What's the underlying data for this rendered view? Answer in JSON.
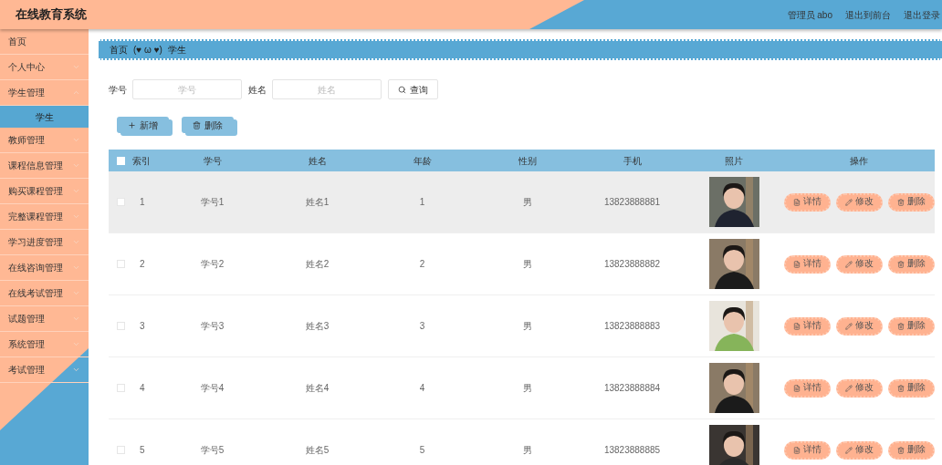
{
  "header": {
    "title": "在线教育系统",
    "links": [
      "管理员 abo",
      "退出到前台",
      "退出登录"
    ]
  },
  "sidebar": {
    "items": [
      {
        "label": "首页",
        "has_children": false,
        "selected": false
      },
      {
        "label": "个人中心",
        "expanded": false,
        "has_children": true,
        "selected": false
      },
      {
        "label": "学生管理",
        "expanded": true,
        "has_children": true,
        "selected": false,
        "children": [
          {
            "label": "学生",
            "selected": true
          }
        ]
      },
      {
        "label": "教师管理",
        "expanded": false,
        "has_children": true,
        "selected": false
      },
      {
        "label": "课程信息管理",
        "expanded": false,
        "has_children": true,
        "selected": false
      },
      {
        "label": "购买课程管理",
        "expanded": false,
        "has_children": true,
        "selected": false
      },
      {
        "label": "完整课程管理",
        "expanded": false,
        "has_children": true,
        "selected": false
      },
      {
        "label": "学习进度管理",
        "expanded": false,
        "has_children": true,
        "selected": false
      },
      {
        "label": "在线咨询管理",
        "expanded": false,
        "has_children": true,
        "selected": false
      },
      {
        "label": "在线考试管理",
        "expanded": false,
        "has_children": true,
        "selected": false
      },
      {
        "label": "试题管理",
        "expanded": false,
        "has_children": true,
        "selected": false
      },
      {
        "label": "系统管理",
        "expanded": false,
        "has_children": true,
        "selected": false
      },
      {
        "label": "考试管理",
        "expanded": false,
        "has_children": true,
        "selected": false
      }
    ]
  },
  "breadcrumb": [
    "首页",
    "(♥ ω ♥)",
    "学生"
  ],
  "search": {
    "fields": [
      {
        "label": "学号",
        "placeholder": "学号"
      },
      {
        "label": "姓名",
        "placeholder": "姓名"
      }
    ],
    "button": "查询"
  },
  "actions": [
    "新增",
    "删除"
  ],
  "table": {
    "columns": [
      "索引",
      "学号",
      "姓名",
      "年龄",
      "性别",
      "手机",
      "照片",
      "操作"
    ],
    "select_all_checked": false,
    "rows": [
      {
        "checked": false,
        "highlighted": true,
        "cells": [
          "1",
          "学号1",
          "姓名1",
          "1",
          "男",
          "13823888881"
        ],
        "buttons": [
          "详情",
          "修改",
          "删除"
        ]
      },
      {
        "checked": false,
        "highlighted": false,
        "cells": [
          "2",
          "学号2",
          "姓名2",
          "2",
          "男",
          "13823888882"
        ],
        "buttons": [
          "详情",
          "修改",
          "删除"
        ]
      },
      {
        "checked": false,
        "highlighted": false,
        "cells": [
          "3",
          "学号3",
          "姓名3",
          "3",
          "男",
          "13823888883"
        ],
        "buttons": [
          "详情",
          "修改",
          "删除"
        ]
      },
      {
        "checked": false,
        "highlighted": false,
        "cells": [
          "4",
          "学号4",
          "姓名4",
          "4",
          "男",
          "13823888884"
        ],
        "buttons": [
          "详情",
          "修改",
          "删除"
        ]
      },
      {
        "checked": false,
        "highlighted": false,
        "cells": [
          "5",
          "学号5",
          "姓名5",
          "5",
          "男",
          "13823888885"
        ],
        "buttons": [
          "详情",
          "修改",
          "删除"
        ]
      }
    ]
  }
}
